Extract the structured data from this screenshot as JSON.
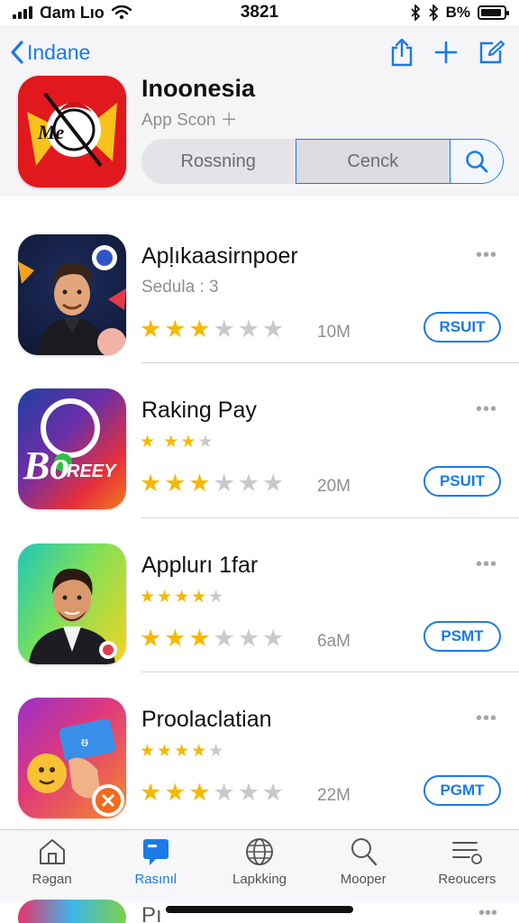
{
  "status_bar": {
    "carrier": "Ɑam Lıo",
    "time": "3821",
    "battery": "B%",
    "battery_level": 0.9,
    "icons": [
      "signal-icon",
      "wifi-icon",
      "bluetooth-icon",
      "battery-icon"
    ]
  },
  "nav": {
    "back_label": "Indane",
    "actions": [
      "share-icon",
      "plus-icon",
      "compose-icon"
    ]
  },
  "hero": {
    "title": "Inoonesia",
    "subtitle": "App Scon ＋",
    "icon_text": "Me"
  },
  "segmented": {
    "options": [
      "Rossning",
      "Cenck"
    ],
    "selected": "Cenck",
    "search_icon": "search-icon"
  },
  "apps": [
    {
      "name": "Apḷıkaasirnpoer",
      "sub": "Sedula : 3",
      "rating": 3,
      "rating_small": null,
      "size": "10M",
      "button": "RSUIT",
      "more": "•••"
    },
    {
      "name": "Raking Pay",
      "sub": "",
      "rating": 3,
      "rating_small": 3,
      "size": "20M",
      "button": "PSUIT",
      "more": "•••"
    },
    {
      "name": "Applurı 1far",
      "sub": "",
      "rating": 3,
      "rating_small": 4,
      "size": "6aM",
      "button": "PSMT",
      "more": "•••"
    },
    {
      "name": "Proolaclatian",
      "sub": "",
      "rating": 3,
      "rating_small": 4,
      "size": "22M",
      "button": "PGMT",
      "more": "•••"
    }
  ],
  "peek": {
    "text": "Pı",
    "more": "•••"
  },
  "tabs": [
    {
      "label": "Rəgan",
      "icon": "home-icon",
      "active": false
    },
    {
      "label": "Rasınıl",
      "icon": "featured-icon",
      "active": true
    },
    {
      "label": "Lapkking",
      "icon": "globe-icon",
      "active": false
    },
    {
      "label": "Mooper",
      "icon": "search-icon",
      "active": false
    },
    {
      "label": "Reoucers",
      "icon": "updates-icon",
      "active": false
    }
  ],
  "colors": {
    "accent": "#1a7ae8",
    "star": "#f5b800",
    "star_off": "#c9c9cc"
  }
}
